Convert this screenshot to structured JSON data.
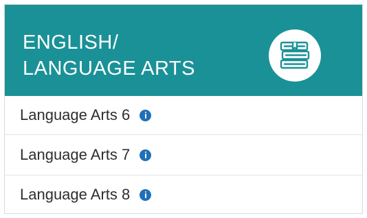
{
  "header": {
    "title_line1": "ENGLISH/",
    "title_line2": "LANGUAGE ARTS",
    "icon": "books-icon",
    "background_color": "#1a9197"
  },
  "courses": [
    {
      "label": "Language Arts 6",
      "icon": "info-icon"
    },
    {
      "label": "Language Arts 7",
      "icon": "info-icon"
    },
    {
      "label": "Language Arts 8",
      "icon": "info-icon"
    }
  ],
  "colors": {
    "info_icon": "#1f70b8",
    "text": "#2e2e2e"
  }
}
